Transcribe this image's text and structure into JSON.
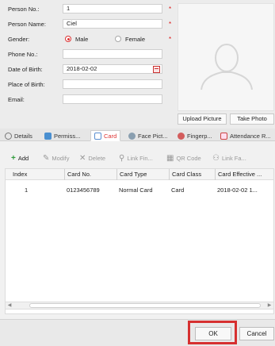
{
  "form": {
    "person_no": {
      "label": "Person No.:",
      "value": "1",
      "required": "*"
    },
    "person_name": {
      "label": "Person Name:",
      "value": "Ciel",
      "required": "*"
    },
    "gender": {
      "label": "Gender:",
      "male": "Male",
      "female": "Female",
      "selected": "Male",
      "required": "*"
    },
    "phone_no": {
      "label": "Phone No.:",
      "value": ""
    },
    "date_of_birth": {
      "label": "Date of Birth:",
      "value": "2018-02-02"
    },
    "place_of_birth": {
      "label": "Place of Birth:",
      "value": ""
    },
    "email": {
      "label": "Email:",
      "value": ""
    }
  },
  "photo": {
    "upload_label": "Upload Picture",
    "take_label": "Take Photo",
    "icon": "person-silhouette-icon"
  },
  "tabs": [
    {
      "label": "Details",
      "icon": "gear-icon",
      "active": false
    },
    {
      "label": "Permiss...",
      "icon": "users-icon",
      "active": false
    },
    {
      "label": "Card",
      "icon": "card-icon",
      "active": true
    },
    {
      "label": "Face Pict...",
      "icon": "person-icon",
      "active": false
    },
    {
      "label": "Fingerp...",
      "icon": "fingerprint-icon",
      "active": false
    },
    {
      "label": "Attendance R...",
      "icon": "calendar-icon",
      "active": false
    }
  ],
  "toolbar": {
    "add": "Add",
    "modify": "Modify",
    "delete": "Delete",
    "link_fin": "Link Fin...",
    "qr_code": "QR Code",
    "link_fa": "Link Fa..."
  },
  "table": {
    "headers": [
      "Index",
      "Card No.",
      "Card Type",
      "Card Class",
      "Card Effective ..."
    ],
    "rows": [
      [
        "1",
        "0123456789",
        "Normal Card",
        "Card",
        "2018-02-02 1..."
      ]
    ]
  },
  "footer": {
    "ok_label": "OK",
    "cancel_label": "Cancel"
  },
  "colors": {
    "accent": "#d33333",
    "highlight": "#d63030"
  }
}
